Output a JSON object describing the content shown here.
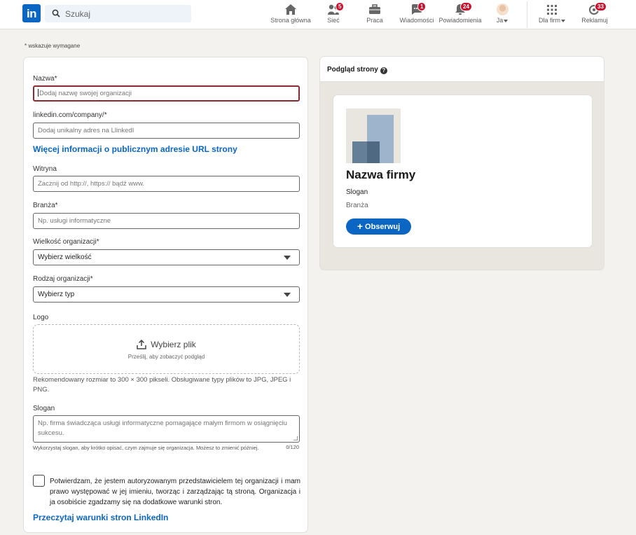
{
  "nav": {
    "logo_text": "in",
    "search_placeholder": "Szukaj",
    "items": [
      {
        "label": "Strona główna",
        "badge": ""
      },
      {
        "label": "Sieć",
        "badge": "5"
      },
      {
        "label": "Praca",
        "badge": ""
      },
      {
        "label": "Wiadomości",
        "badge": "1"
      },
      {
        "label": "Powiadomienia",
        "badge": "24"
      },
      {
        "label": "Ja",
        "badge": ""
      },
      {
        "label": "Dla firm",
        "badge": ""
      },
      {
        "label": "Reklamuj",
        "badge": "33"
      }
    ],
    "accent_color": "#0a66c2",
    "badge_color": "#cb112d"
  },
  "required_note": "*  wskazuje wymagane",
  "form": {
    "name_label": "Nazwa*",
    "name_placeholder": "Dodaj nazwę swojej organizacji",
    "url_label": "linkedin.com/company/*",
    "url_placeholder": "Dodaj unikalny adres na LlinkedI",
    "url_info_link": "Więcej informacji o publicznym adresie URL strony",
    "website_label": "Witryna",
    "website_placeholder": "Zacznij od http://, https:// bądź www.",
    "industry_label": "Branża*",
    "industry_placeholder": "Np. usługi informatyczne",
    "size_label": "Wielkość organizacji*",
    "size_value": "Wybierz wielkość",
    "type_label": "Rodzaj organizacji*",
    "type_value": "Wybierz typ",
    "logo_label": "Logo",
    "upload_title": "Wybierz plik",
    "upload_sub": "Prześlij, aby zobaczyć podgląd",
    "logo_help": "Rekomendowany rozmiar to 300 × 300 pikseli. Obsługiwane typy plików to JPG, JPEG i PNG.",
    "tagline_label": "Slogan",
    "tagline_placeholder": "Np. firma świadcząca usługi informatyczne pomagające małym firmom w osiągnięciu sukcesu.",
    "tagline_help": "Wykorzystaj slogan, aby krótko opisać, czym zajmuje się organizacja. Możesz to zmienić później.",
    "tagline_counter": "0/120",
    "confirm_text": "Potwierdzam, że jestem autoryzowanym przedstawicielem tej organizacji i mam prawo występować w jej imieniu, tworząc i zarządzając tą stroną. Organizacja i ja osobiście zgadzamy się na dodatkowe warunki stron.",
    "terms_link": "Przeczytaj warunki stron LinkedIn",
    "error_color": "#8a2a31"
  },
  "preview": {
    "title": "Podgląd strony",
    "company_name": "Nazwa firmy",
    "tagline": "Slogan",
    "industry": "Branża",
    "follow_label": "Obserwuj"
  }
}
